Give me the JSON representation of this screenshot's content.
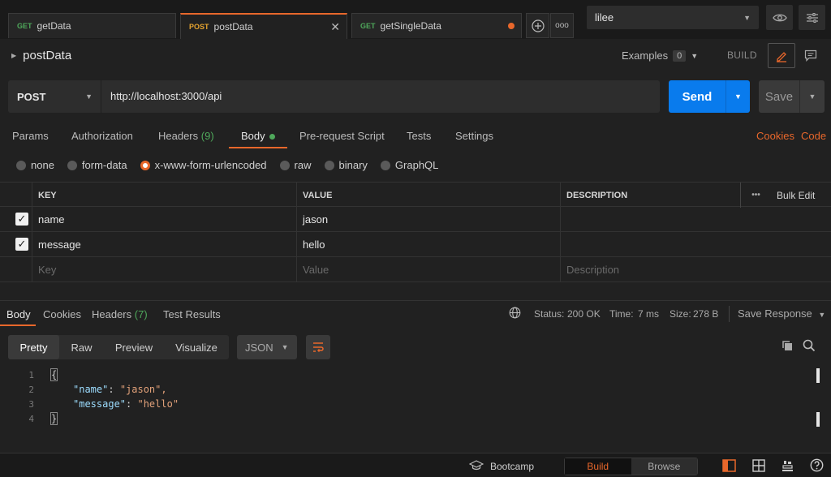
{
  "tabs": [
    {
      "method": "GET",
      "name": "getData"
    },
    {
      "method": "POST",
      "name": "postData"
    },
    {
      "method": "GET",
      "name": "getSingleData"
    }
  ],
  "env": {
    "name": "lilee"
  },
  "request": {
    "name": "postData",
    "examples_label": "Examples",
    "examples_count": "0",
    "build_label": "BUILD",
    "method": "POST",
    "url": "http://localhost:3000/api",
    "send_label": "Send",
    "save_label": "Save"
  },
  "req_tabs": {
    "params": "Params",
    "authorization": "Authorization",
    "headers": "Headers",
    "headers_count": "(9)",
    "body": "Body",
    "prerequest": "Pre-request Script",
    "tests": "Tests",
    "settings": "Settings",
    "cookies": "Cookies",
    "code": "Code"
  },
  "body_types": [
    "none",
    "form-data",
    "x-www-form-urlencoded",
    "raw",
    "binary",
    "GraphQL"
  ],
  "body_type_selected": "x-www-form-urlencoded",
  "table": {
    "headers": {
      "key": "KEY",
      "value": "VALUE",
      "description": "DESCRIPTION",
      "bulk_edit": "Bulk Edit",
      "more": "•••"
    },
    "rows": [
      {
        "key": "name",
        "value": "jason"
      },
      {
        "key": "message",
        "value": "hello"
      }
    ],
    "placeholder": {
      "key": "Key",
      "value": "Value",
      "description": "Description"
    }
  },
  "response": {
    "tabs": {
      "body": "Body",
      "cookies": "Cookies",
      "headers": "Headers",
      "headers_count": "(7)",
      "tests": "Test Results"
    },
    "status_label": "Status:",
    "status": "200 OK",
    "time_label": "Time:",
    "time": "7 ms",
    "size_label": "Size:",
    "size": "278 B",
    "save_response": "Save Response"
  },
  "view_modes": [
    "Pretty",
    "Raw",
    "Preview",
    "Visualize"
  ],
  "format": "JSON",
  "code_lines": [
    {
      "num": "1",
      "text": "{"
    },
    {
      "num": "2",
      "key": "\"name\"",
      "value": "\"jason\","
    },
    {
      "num": "3",
      "key": "\"message\"",
      "value": "\"hello\""
    },
    {
      "num": "4",
      "text": "}"
    }
  ],
  "footer": {
    "bootcamp": "Bootcamp",
    "build": "Build",
    "browse": "Browse"
  },
  "colors": {
    "accent": "#e8672b",
    "send": "#097bed",
    "ok": "#4fa85b"
  }
}
